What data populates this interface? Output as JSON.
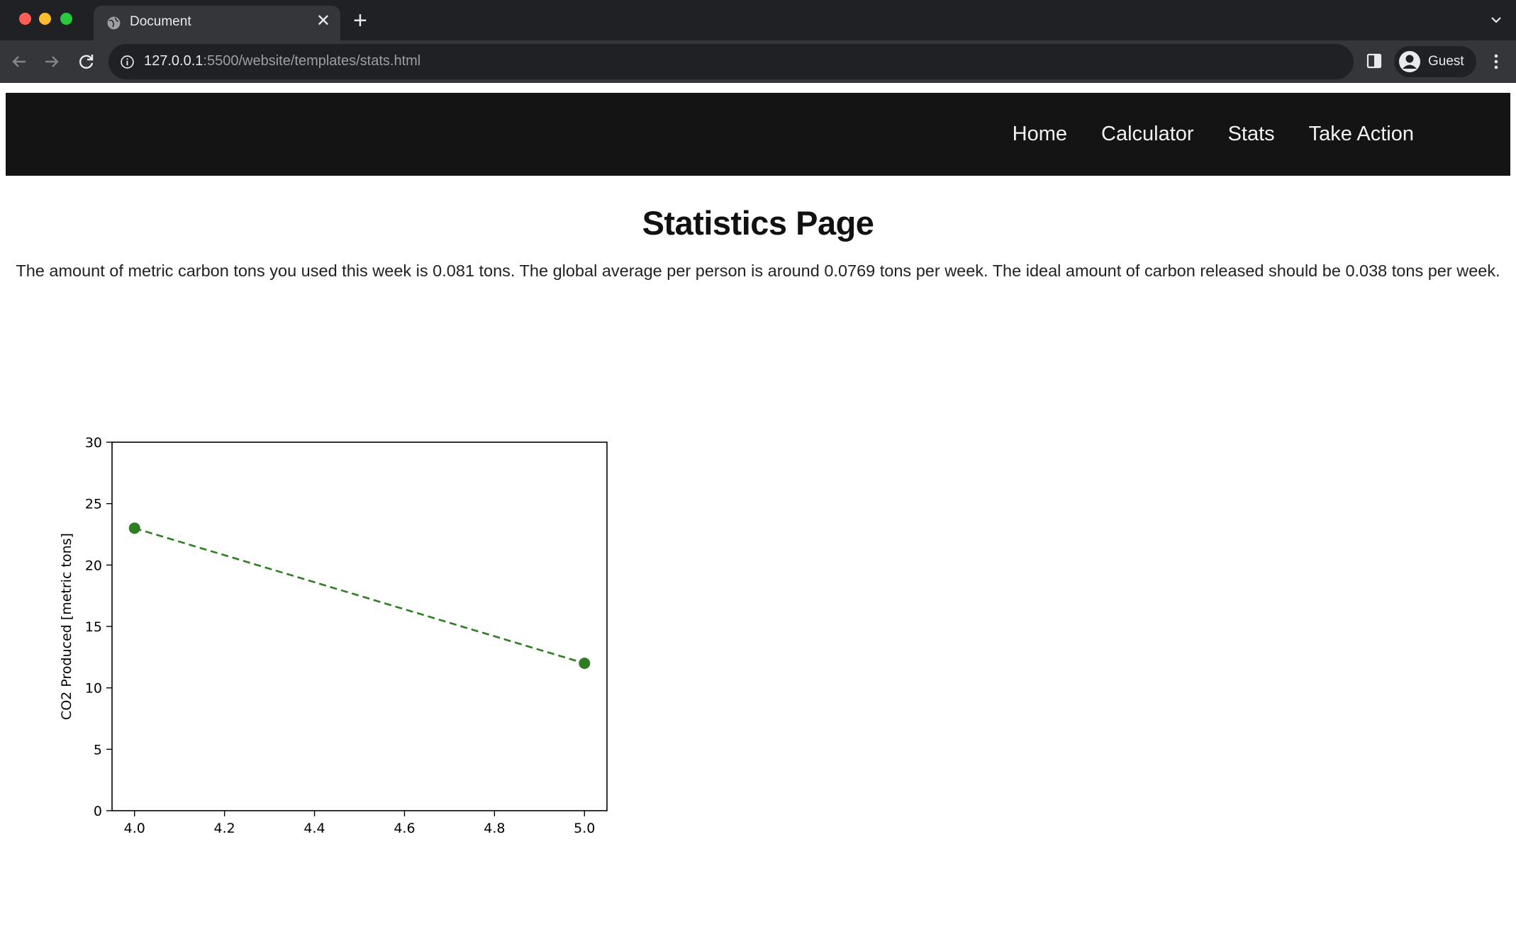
{
  "browser": {
    "tab_title": "Document",
    "url_host": "127.0.0.1",
    "url_rest": ":5500/website/templates/stats.html",
    "profile_label": "Guest"
  },
  "nav": {
    "items": [
      {
        "label": "Home"
      },
      {
        "label": "Calculator"
      },
      {
        "label": "Stats"
      },
      {
        "label": "Take Action"
      }
    ]
  },
  "main": {
    "title": "Statistics Page",
    "summary": "The amount of metric carbon tons you used this week is 0.081 tons. The global average per person is around 0.0769 tons per week. The ideal amount of carbon released should be 0.038 tons per week."
  },
  "chart_data": {
    "type": "line",
    "title": "",
    "xlabel": "",
    "ylabel": "CO2 Produced [metric tons]",
    "x": [
      4.0,
      5.0
    ],
    "series": [
      {
        "values": [
          23,
          12
        ],
        "color": "#2e7d22",
        "line_style": "dashed",
        "marker": "circle"
      }
    ],
    "xlim": [
      3.95,
      5.05
    ],
    "ylim": [
      0,
      30
    ],
    "xticks": [
      "4.0",
      "4.2",
      "4.4",
      "4.6",
      "4.8",
      "5.0"
    ],
    "yticks": [
      "0",
      "5",
      "10",
      "15",
      "20",
      "25",
      "30"
    ],
    "grid": false
  }
}
